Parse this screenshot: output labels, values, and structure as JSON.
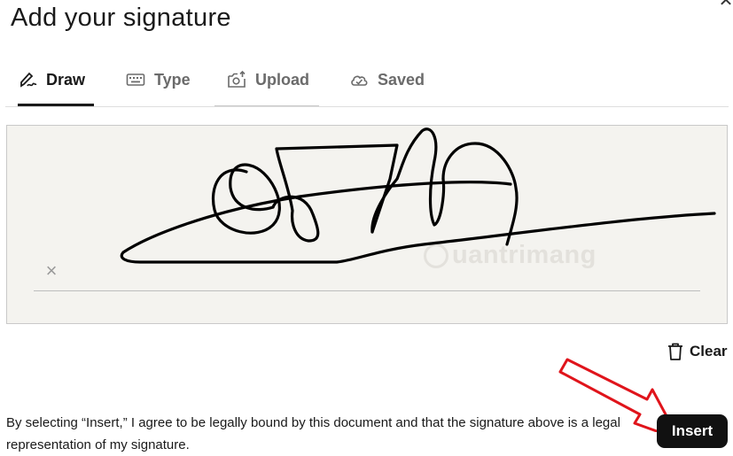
{
  "dialog": {
    "title": "Add your signature",
    "close_icon": "close-icon"
  },
  "tabs": [
    {
      "label": "Draw",
      "icon": "pen-icon",
      "active": true
    },
    {
      "label": "Type",
      "icon": "keyboard-icon",
      "active": false
    },
    {
      "label": "Upload",
      "icon": "camera-upload-icon",
      "active": false
    },
    {
      "label": "Saved",
      "icon": "cloud-icon",
      "active": false
    }
  ],
  "canvas": {
    "clear_icon": "x-icon",
    "watermark": "uantrimang",
    "background": "#f4f3ef"
  },
  "actions": {
    "clear_label": "Clear",
    "insert_label": "Insert"
  },
  "consent_text": "By selecting “Insert,” I agree to be legally bound by this document and that the signature above is a legal representation of my signature.",
  "colors": {
    "accent": "#111111",
    "annotation_arrow": "#e0141b"
  }
}
